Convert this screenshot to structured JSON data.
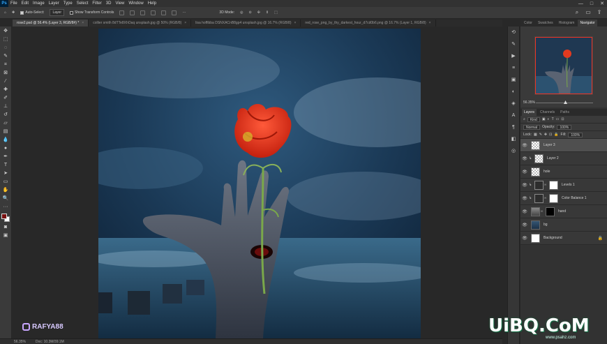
{
  "menubar": {
    "logo": "Ps",
    "items": [
      "File",
      "Edit",
      "Image",
      "Layer",
      "Type",
      "Select",
      "Filter",
      "3D",
      "View",
      "Window",
      "Help"
    ],
    "window_controls": [
      "—",
      "□",
      "✕"
    ]
  },
  "options": {
    "auto_select_label": "Auto-Select:",
    "auto_select_target": "Layer",
    "show_transform_label": "Show Transform Controls",
    "mode_3d_label": "3D Mode:"
  },
  "tabs": [
    {
      "label": "rose2.psd @ 56.4% (Layer 3, RGB/8#) *",
      "active": true
    },
    {
      "label": "collier smith 8dTTe8XhOaq unsplash.jpg @ 50% (RGB/8)",
      "active": false
    },
    {
      "label": "lisa hoffibba DSNXACnB8gp4 unsplash.jpg @ 16.7% (RGB/8)",
      "active": false
    },
    {
      "label": "red_rose_png_by_thy_darkest_hour_d7cd0b6.png @ 16.7% (Layer 1, RGB/8)",
      "active": false
    }
  ],
  "watermark": {
    "handle": "RAFYA88"
  },
  "status": {
    "zoom": "56.35%",
    "doc": "Doc: 10.3M/39.1M"
  },
  "panels": {
    "top_tabs": [
      "Color",
      "Swatches",
      "Histogram",
      "Navigator"
    ],
    "active_top_tab": "Navigator",
    "navigator_zoom": "56.35%",
    "layers_tabs": [
      "Layers",
      "Channels",
      "Paths"
    ],
    "active_layers_tab": "Layers",
    "kind_label": "Kind",
    "blend_mode": "Normal",
    "opacity_label": "Opacity:",
    "opacity_value": "100%",
    "lock_label": "Lock:",
    "fill_label": "Fill:",
    "fill_value": "100%"
  },
  "layers": [
    {
      "name": "Layer 3",
      "thumb": "checker",
      "selected": true
    },
    {
      "name": "Layer 2",
      "thumb": "checker",
      "selected": false
    },
    {
      "name": "hole",
      "thumb": "checker",
      "selected": false
    },
    {
      "name": "Levels 1",
      "thumb": "adj",
      "selected": false
    },
    {
      "name": "Color Balance 1",
      "thumb": "adj",
      "selected": false
    },
    {
      "name": "hand",
      "thumb": "hand",
      "selected": false
    },
    {
      "name": "bg",
      "thumb": "photo",
      "selected": false
    },
    {
      "name": "Background",
      "thumb": "white",
      "selected": false
    }
  ],
  "brand": {
    "text": "UiBQ.CoM",
    "sub": "www.psahz.com"
  }
}
